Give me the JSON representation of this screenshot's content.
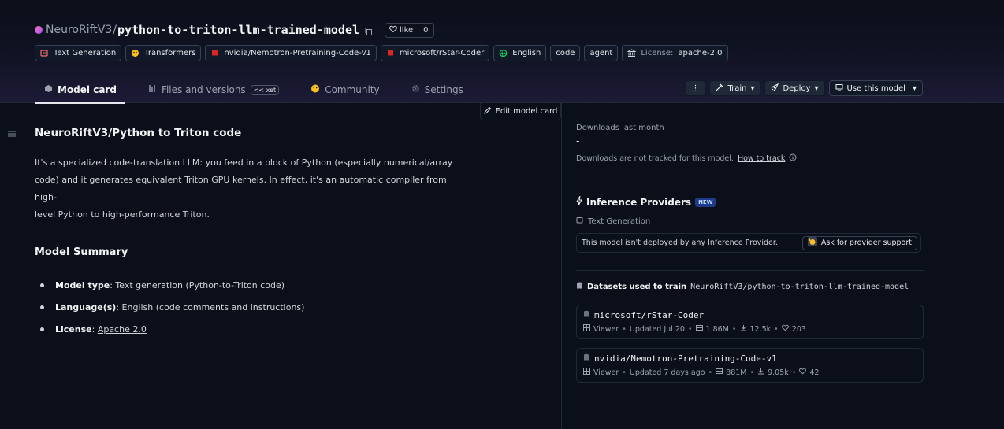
{
  "repo": {
    "owner": "NeuroRiftV3",
    "name": "python-to-triton-llm-trained-model",
    "like_label": "like",
    "like_count": "0"
  },
  "tags": [
    {
      "label": "Text Generation",
      "icon": "text-generation-icon"
    },
    {
      "label": "Transformers",
      "icon": "transformers-icon"
    },
    {
      "label": "nvidia/Nemotron-Pretraining-Code-v1",
      "icon": "dataset-icon"
    },
    {
      "label": "microsoft/rStar-Coder",
      "icon": "dataset-icon"
    },
    {
      "label": "English",
      "icon": "globe-icon"
    },
    {
      "label": "code"
    },
    {
      "label": "agent"
    },
    {
      "key": "License:",
      "label": "apache-2.0",
      "icon": "license-icon"
    }
  ],
  "tabs": [
    {
      "label": "Model card",
      "active": true
    },
    {
      "label": "Files and versions",
      "badge": "xet"
    },
    {
      "label": "Community"
    },
    {
      "label": "Settings"
    }
  ],
  "actions": {
    "more": "⋮",
    "train": "Train",
    "deploy": "Deploy",
    "use": "Use this model"
  },
  "edit_card": "Edit model card",
  "content": {
    "title": "NeuroRiftV3/Python to Triton code",
    "para_lines": [
      "It's a specialized code-translation LLM: you feed in a block of Python (especially numerical/array",
      "code) and it generates equivalent Triton GPU kernels. In effect, it's an automatic compiler from high-",
      "level Python to high-performance Triton."
    ],
    "summary_title": "Model Summary",
    "summary": [
      {
        "key": "Model type",
        "value": ": Text generation (Python-to-Triton code)"
      },
      {
        "key": "Language(s)",
        "value": ": English (code comments and instructions)"
      },
      {
        "key": "License",
        "value": ": ",
        "link": "Apache 2.0"
      }
    ]
  },
  "downloads": {
    "label": "Downloads last month",
    "value": "-",
    "note": "Downloads are not tracked for this model.",
    "link": "How to track"
  },
  "inference": {
    "title": "Inference Providers",
    "badge": "NEW",
    "task": "Text Generation",
    "message": "This model isn't deployed by any Inference Provider.",
    "ask": "Ask for provider support"
  },
  "datasets": {
    "title": "Datasets used to train",
    "repo": "NeuroRiftV3/python-to-triton-llm-trained-model",
    "items": [
      {
        "name": "microsoft/rStar-Coder",
        "viewer": "Viewer",
        "updated": "Updated Jul 20",
        "rows": "1.86M",
        "downloads": "12.5k",
        "likes": "203"
      },
      {
        "name": "nvidia/Nemotron-Pretraining-Code-v1",
        "viewer": "Viewer",
        "updated": "Updated 7 days ago",
        "rows": "881M",
        "downloads": "9.05k",
        "likes": "42"
      }
    ]
  }
}
